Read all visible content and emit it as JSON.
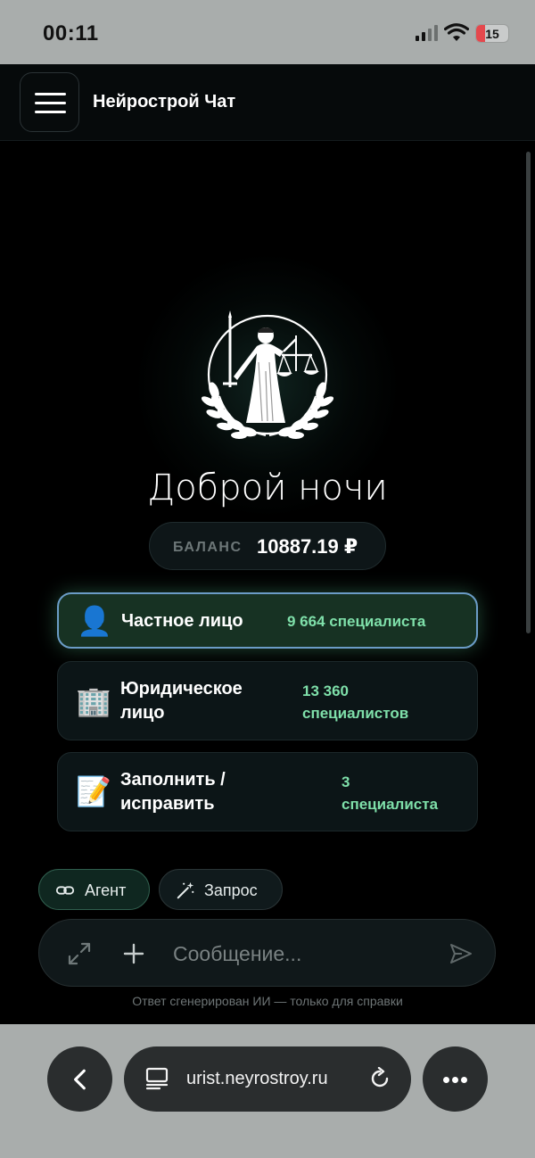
{
  "status_bar": {
    "time": "00:11",
    "battery": "15"
  },
  "header": {
    "title": "Нейрострой Чат"
  },
  "greeting": "Доброй ночи",
  "balance": {
    "label": "БАЛАНС",
    "value": "10887.19 ₽"
  },
  "cards": [
    {
      "icon": "👤",
      "icon_name": "person-icon",
      "title_lines": [
        "Частное лицо"
      ],
      "count_lines": [
        "9 664 специалиста"
      ]
    },
    {
      "icon": "🏢",
      "icon_name": "office-building-icon",
      "title_lines": [
        "Юридическое",
        "лицо"
      ],
      "count_lines": [
        "13 360",
        "специалистов"
      ]
    },
    {
      "icon": "📝",
      "icon_name": "memo-icon",
      "title_lines": [
        "Заполнить /",
        "исправить"
      ],
      "count_lines": [
        "3",
        "специалиста"
      ]
    }
  ],
  "chips": {
    "agent": "Агент",
    "request": "Запрос"
  },
  "composer": {
    "placeholder": "Сообщение..."
  },
  "disclaimer": "Ответ сгенерирован ИИ — только для справки",
  "browser": {
    "url": "urist.neyrostroy.ru"
  },
  "colors": {
    "accent_green": "#7fe0aa",
    "active_border": "#6b9cc7",
    "background": "#000000"
  }
}
